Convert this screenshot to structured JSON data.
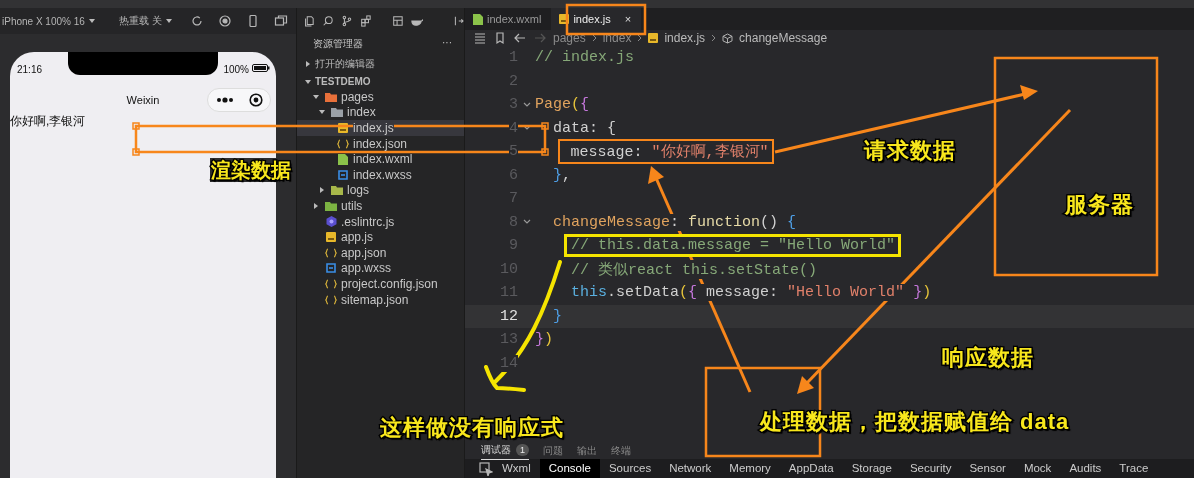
{
  "simulator": {
    "device": "iPhone X 100% 16",
    "hot_reload": "热重载 关",
    "phone": {
      "time": "21:16",
      "battery": "100%",
      "nav_title": "Weixin",
      "content": "你好啊,李银河"
    }
  },
  "explorer": {
    "title": "资源管理器",
    "more": "···",
    "sections": [
      {
        "label": "打开的编辑器",
        "expanded": false
      },
      {
        "label": "TESTDEMO",
        "expanded": true
      }
    ],
    "tree": [
      {
        "label": "pages",
        "kind": "folder",
        "color": "#e8703a",
        "expanded": true,
        "selected": false,
        "children": [
          {
            "label": "index",
            "kind": "folder",
            "color": "#9aa0a6",
            "expanded": true,
            "selected": false,
            "children": [
              {
                "label": "index.js",
                "kind": "js",
                "selected": true
              },
              {
                "label": "index.json",
                "kind": "json",
                "selected": false
              },
              {
                "label": "index.wxml",
                "kind": "wxml",
                "selected": false
              },
              {
                "label": "index.wxss",
                "kind": "wxss",
                "selected": false
              }
            ]
          },
          {
            "label": "logs",
            "kind": "folder",
            "color": "#a8b84a",
            "expanded": false,
            "selected": false
          }
        ]
      },
      {
        "label": "utils",
        "kind": "folder",
        "color": "#7cb342",
        "expanded": false,
        "selected": false
      },
      {
        "label": ".eslintrc.js",
        "kind": "eslint",
        "selected": false
      },
      {
        "label": "app.js",
        "kind": "js",
        "selected": false
      },
      {
        "label": "app.json",
        "kind": "json",
        "selected": false
      },
      {
        "label": "app.wxss",
        "kind": "wxss",
        "selected": false
      },
      {
        "label": "project.config.json",
        "kind": "json",
        "selected": false
      },
      {
        "label": "sitemap.json",
        "kind": "json",
        "selected": false
      }
    ]
  },
  "editor": {
    "tabs": [
      {
        "label": "index.wxml",
        "kind": "wxml",
        "selected": false
      },
      {
        "label": "index.js",
        "kind": "js",
        "selected": true,
        "close": "×"
      }
    ],
    "breadcrumb": [
      {
        "label": "pages",
        "kind": "folder"
      },
      {
        "label": "index",
        "kind": "folder"
      },
      {
        "label": "index.js",
        "kind": "js"
      },
      {
        "label": "changeMessage",
        "kind": "method"
      }
    ],
    "lines": [
      {
        "number": "1",
        "current": false,
        "foldable": false,
        "tokens": [
          {
            "kind": "comment",
            "text": "// index.js"
          }
        ]
      },
      {
        "number": "2",
        "current": false,
        "foldable": false
      },
      {
        "number": "3",
        "current": false,
        "foldable": true,
        "tokens": [
          {
            "kind": "function",
            "text": "Page"
          },
          {
            "kind": "paren",
            "text": "("
          },
          {
            "kind": "brace",
            "text": "{"
          }
        ]
      },
      {
        "number": "4",
        "current": false,
        "foldable": true,
        "tokens": [
          {
            "kind": "prop",
            "text": "  data"
          },
          {
            "kind": "punct",
            "text": ": {"
          }
        ]
      },
      {
        "number": "5",
        "current": false,
        "foldable": false,
        "tokens": [
          {
            "kind": "prop",
            "text": "    message"
          },
          {
            "kind": "punct",
            "text": ": "
          },
          {
            "kind": "string",
            "text": "\"你好啊,李银河\""
          }
        ]
      },
      {
        "number": "6",
        "current": false,
        "foldable": false,
        "tokens": [
          {
            "kind": "block",
            "text": "  }"
          },
          {
            "kind": "punct",
            "text": ","
          }
        ]
      },
      {
        "number": "7",
        "current": false,
        "foldable": false
      },
      {
        "number": "8",
        "current": false,
        "foldable": true,
        "tokens": [
          {
            "kind": "function",
            "text": "  changeMessage"
          },
          {
            "kind": "punct",
            "text": ": "
          },
          {
            "kind": "keyword",
            "text": "function"
          },
          {
            "kind": "punct",
            "text": "() "
          },
          {
            "kind": "block",
            "text": "{"
          }
        ]
      },
      {
        "number": "9",
        "current": false,
        "foldable": false,
        "tokens": [
          {
            "kind": "comment",
            "text": "    // this.data.message = \"Hello World\""
          }
        ]
      },
      {
        "number": "10",
        "current": false,
        "foldable": false,
        "tokens": [
          {
            "kind": "comment",
            "text": "    // 类似react this.setState()"
          }
        ]
      },
      {
        "number": "11",
        "current": false,
        "foldable": false,
        "tokens": [
          {
            "kind": "this",
            "text": "    this"
          },
          {
            "kind": "punct",
            "text": ".setData"
          },
          {
            "kind": "paren",
            "text": "("
          },
          {
            "kind": "brace",
            "text": "{"
          },
          {
            "kind": "punct",
            "text": " message: "
          },
          {
            "kind": "string",
            "text": "\"Hello World\""
          },
          {
            "kind": "brace",
            "text": " }"
          },
          {
            "kind": "paren",
            "text": ")"
          }
        ]
      },
      {
        "number": "12",
        "current": true,
        "foldable": false,
        "tokens": [
          {
            "kind": "block",
            "text": "  }"
          }
        ]
      },
      {
        "number": "13",
        "current": false,
        "foldable": false,
        "tokens": [
          {
            "kind": "brace",
            "text": "}"
          },
          {
            "kind": "paren",
            "text": ")"
          }
        ]
      },
      {
        "number": "14",
        "current": false,
        "foldable": false
      }
    ]
  },
  "panel": {
    "tabs": [
      {
        "label": "调试器",
        "badge": "1",
        "selected": true
      },
      {
        "label": "问题",
        "selected": false
      },
      {
        "label": "输出",
        "selected": false
      },
      {
        "label": "终端",
        "selected": false
      }
    ],
    "devtools_tabs": [
      {
        "label": "Wxml",
        "selected": false
      },
      {
        "label": "Console",
        "selected": true
      },
      {
        "label": "Sources",
        "selected": false
      },
      {
        "label": "Network",
        "selected": false
      },
      {
        "label": "Memory",
        "selected": false
      },
      {
        "label": "AppData",
        "selected": false
      },
      {
        "label": "Storage",
        "selected": false
      },
      {
        "label": "Security",
        "selected": false
      },
      {
        "label": "Sensor",
        "selected": false
      },
      {
        "label": "Mock",
        "selected": false
      },
      {
        "label": "Audits",
        "selected": false
      },
      {
        "label": "Trace",
        "selected": false
      }
    ]
  },
  "annotations": [
    {
      "kind": "callout",
      "text": "渲染数据"
    },
    {
      "kind": "callout",
      "text": "请求数据"
    },
    {
      "kind": "callout",
      "text": "服务器"
    },
    {
      "kind": "callout",
      "text": "响应数据"
    },
    {
      "kind": "callout",
      "text": "这样做没有响应式"
    },
    {
      "kind": "callout",
      "text": "处理数据，把数据赋值给 data"
    }
  ]
}
